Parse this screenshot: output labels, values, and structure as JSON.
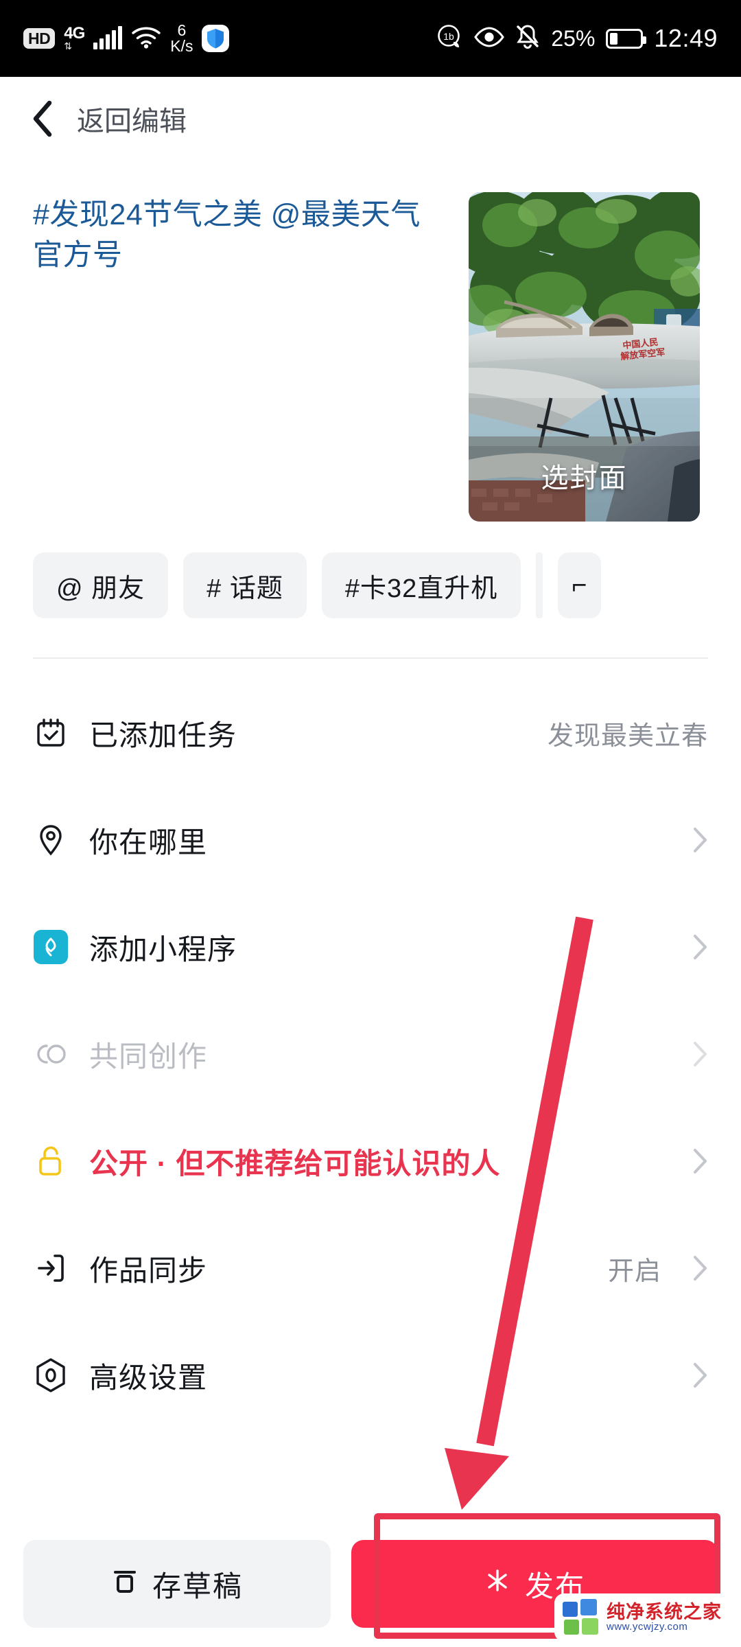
{
  "status_bar": {
    "hd_badge": "HD",
    "network_type": "4G",
    "data_rate_value": "6",
    "data_rate_unit": "K/s",
    "shield_icon": "shield-icon",
    "eco_icon": "eco-leaf-icon",
    "eye_icon": "eye-comfort-icon",
    "mute_icon": "bell-muted-icon",
    "battery_percent": "25%",
    "clock": "12:49"
  },
  "navbar": {
    "back_icon": "back-chevron-icon",
    "title": "返回编辑"
  },
  "compose": {
    "caption": "#发现24节气之美 @最美天气官方号",
    "cover_label": "选封面"
  },
  "chips": [
    {
      "label": "@ 朋友",
      "name": "chip-mention-friend"
    },
    {
      "label": "# 话题",
      "name": "chip-topic"
    },
    {
      "label": "#卡32直升机",
      "name": "chip-hashtag-ka32"
    },
    {
      "label": "⌐",
      "name": "chip-partial"
    }
  ],
  "list": [
    {
      "name": "row-task",
      "icon": "calendar-check-icon",
      "label": "已添加任务",
      "value": "发现最美立春",
      "chevron": false,
      "style": "normal"
    },
    {
      "name": "row-location",
      "icon": "location-pin-icon",
      "label": "你在哪里",
      "value": "",
      "chevron": true,
      "style": "normal"
    },
    {
      "name": "row-miniprogram",
      "icon": "mini-program-icon",
      "label": "添加小程序",
      "value": "",
      "chevron": true,
      "style": "normal"
    },
    {
      "name": "row-coauthor",
      "icon": "co-create-icon",
      "label": "共同创作",
      "value": "",
      "chevron": true,
      "style": "muted"
    },
    {
      "name": "row-privacy",
      "icon": "unlock-icon",
      "label": "公开 · 但不推荐给可能认识的人",
      "value": "",
      "chevron": true,
      "style": "danger"
    },
    {
      "name": "row-sync",
      "icon": "sync-export-icon",
      "label": "作品同步",
      "value": "开启",
      "chevron": true,
      "style": "normal"
    },
    {
      "name": "row-advanced",
      "icon": "advanced-settings-icon",
      "label": "高级设置",
      "value": "",
      "chevron": true,
      "style": "normal"
    }
  ],
  "bottom_bar": {
    "draft_label": "存草稿",
    "draft_icon": "draft-box-icon",
    "publish_label": "发布",
    "publish_icon": "sparkle-icon"
  },
  "watermark": {
    "title": "纯净系统之家",
    "url": "www.ycwjzy.com"
  },
  "colors": {
    "accent_red": "#fa2b4d",
    "danger_text": "#e8344e",
    "caption_blue": "#1b5a96",
    "chip_bg": "#f2f3f5",
    "miniprogram_cyan": "#19b4d4",
    "lock_yellow": "#f5c518"
  }
}
